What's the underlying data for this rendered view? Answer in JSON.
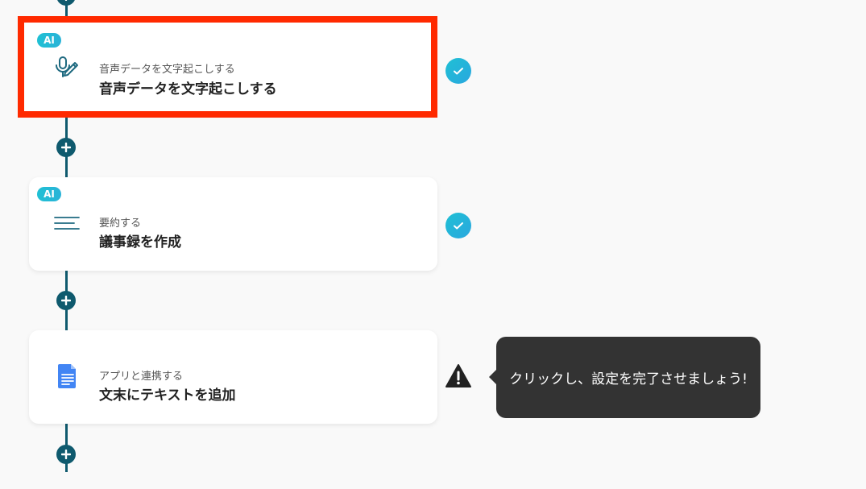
{
  "flow": {
    "steps": [
      {
        "badge": "AI",
        "icon": "microphone-pen-icon",
        "subtitle": "音声データを文字起こしする",
        "title": "音声データを文字起こしする",
        "status": "complete"
      },
      {
        "badge": "AI",
        "icon": "text-lines-icon",
        "subtitle": "要約する",
        "title": "議事録を作成",
        "status": "complete"
      },
      {
        "badge": "",
        "icon": "google-docs-icon",
        "subtitle": "アプリと連携する",
        "title": "文末にテキストを追加",
        "status": "warning"
      }
    ],
    "add_step_icon": "plus-icon"
  },
  "tooltip": {
    "text": "クリックし、設定を完了させましょう!"
  },
  "colors": {
    "connector": "#0f5a6e",
    "highlight_border": "#ff2a00",
    "ai_badge": "#1fc0d4",
    "check": "#22b5d9",
    "tooltip_bg": "#333333",
    "docs_blue": "#4285f4"
  }
}
